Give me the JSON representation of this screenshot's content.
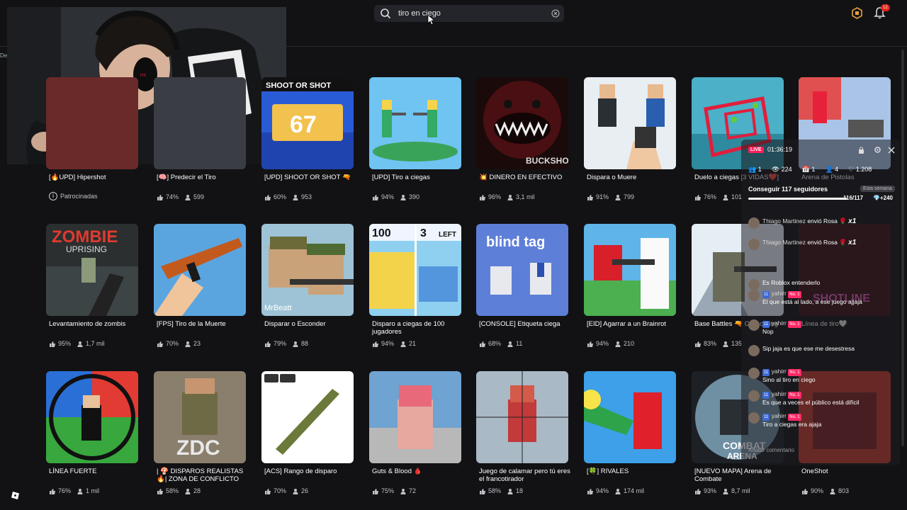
{
  "search": {
    "query": "tiro en ciego"
  },
  "notifications": {
    "count": "12"
  },
  "edge_text": "De",
  "sponsored_label": "Patrocinadas",
  "rows": [
    [
      {
        "title": "[🔥UPD] Hipershot",
        "sponsored": true
      },
      {
        "title": "[🧠] Predecir el Tiro",
        "rating": "74%",
        "players": "599"
      },
      {
        "title": "[UPD] SHOOT OR SHOT 🔫",
        "rating": "60%",
        "players": "953"
      },
      {
        "title": "[UPD] Tiro a ciegas",
        "rating": "94%",
        "players": "390"
      },
      {
        "title": "💥 DINERO EN EFECTIVO",
        "rating": "96%",
        "players": "3,1 mil"
      },
      {
        "title": "Dispara o Muere",
        "rating": "91%",
        "players": "799"
      },
      {
        "title": "Duelo a ciegas [3 VIDAS❤️]",
        "rating": "76%",
        "players": "101"
      },
      {
        "title": "Arena de Pistolas",
        "rating": "",
        "players": ""
      }
    ],
    [
      {
        "title": "Levantamiento de zombis",
        "rating": "95%",
        "players": "1,7 mil"
      },
      {
        "title": "[FPS] Tiro de la Muerte",
        "rating": "70%",
        "players": "23"
      },
      {
        "title": "Disparar o Esconder",
        "rating": "79%",
        "players": "88"
      },
      {
        "title": "Disparo a ciegas de 100 jugadores",
        "rating": "94%",
        "players": "21"
      },
      {
        "title": "[CONSOLE] Etiqueta ciega",
        "rating": "68%",
        "players": "11"
      },
      {
        "title": "[EID] Agarrar a un Brainrot",
        "rating": "94%",
        "players": "210"
      },
      {
        "title": "Base Battles 🔫 G Shooting",
        "rating": "83%",
        "players": "135"
      },
      {
        "title": "Línea de tiro🤍",
        "rating": "",
        "players": ""
      }
    ],
    [
      {
        "title": "LÍNEA FUERTE",
        "rating": "76%",
        "players": "1 mil"
      },
      {
        "title": "| 🍄 DISPAROS REALISTAS 🔥| ZONA DE CONFLICTO",
        "rating": "58%",
        "players": "28"
      },
      {
        "title": "[ACS] Rango de disparo",
        "rating": "70%",
        "players": "26"
      },
      {
        "title": "Guts & Blood 🩸",
        "rating": "75%",
        "players": "72"
      },
      {
        "title": "Juego de calamar pero tú eres el francotirador",
        "rating": "58%",
        "players": "18"
      },
      {
        "title": "[🍀] RIVALES",
        "rating": "94%",
        "players": "174 mil"
      },
      {
        "title": "[NUEVO MAPA] Arena de Combate",
        "rating": "93%",
        "players": "8,7 mil"
      },
      {
        "title": "OneShot",
        "rating": "90%",
        "players": "803"
      }
    ]
  ],
  "thumb_text": {
    "shoot_or_shot": "SHOOT OR SHOT",
    "shoot_or_shot_num": "67",
    "buckshot": "BUCKSHOT",
    "zombie": "ZOMBIE",
    "uprising": "UPRISING",
    "mrbeatt": "MrBeatt",
    "hundred": "100",
    "three_left": "3",
    "left": "LEFT",
    "blind_tag": "blind tag",
    "zdc": "ZDC",
    "combat_arena_1": "COMBAT",
    "combat_arena_2": "ARENA",
    "hotline": "SHOTLINE"
  },
  "chat": {
    "live": "LIVE",
    "time": "01:36:19",
    "stats": {
      "a": "1",
      "viewers": "224",
      "c": "1",
      "d": "4",
      "likes": "1.208"
    },
    "goal": {
      "title": "Conseguir 117 seguidores",
      "period": "Esta semana",
      "count": "116/117",
      "gift": "+240",
      "progress": 0.99
    },
    "messages": [
      {
        "user": "Thiago Martinez",
        "text": "envió Rosa",
        "gift": "x1"
      },
      {
        "user": "Thiago Martinez",
        "text": "envió Rosa",
        "gift": "x1"
      },
      {
        "user": "",
        "text": "Es Roblox entenderlo"
      },
      {
        "user": "yahirr",
        "level": "11",
        "rank": "No. 1",
        "text": "El que está al lado, a ese juego ajjaja"
      },
      {
        "user": "yahirr",
        "level": "11",
        "rank": "No. 1",
        "text": "Nop"
      },
      {
        "user": "",
        "text": "Sip jaja es que ese me desestresa"
      },
      {
        "user": "yahirr",
        "level": "11",
        "rank": "No. 1",
        "text": "Sino al tiro en ciego"
      },
      {
        "user": "yahirr",
        "level": "11",
        "rank": "No. 1",
        "text": "Es que a veces el público está difícil"
      },
      {
        "user": "yahirr",
        "level": "11",
        "rank": "No. 1",
        "text": "Tiro a ciegas era ajaja"
      }
    ],
    "input_placeholder": "Añadir comentario"
  }
}
